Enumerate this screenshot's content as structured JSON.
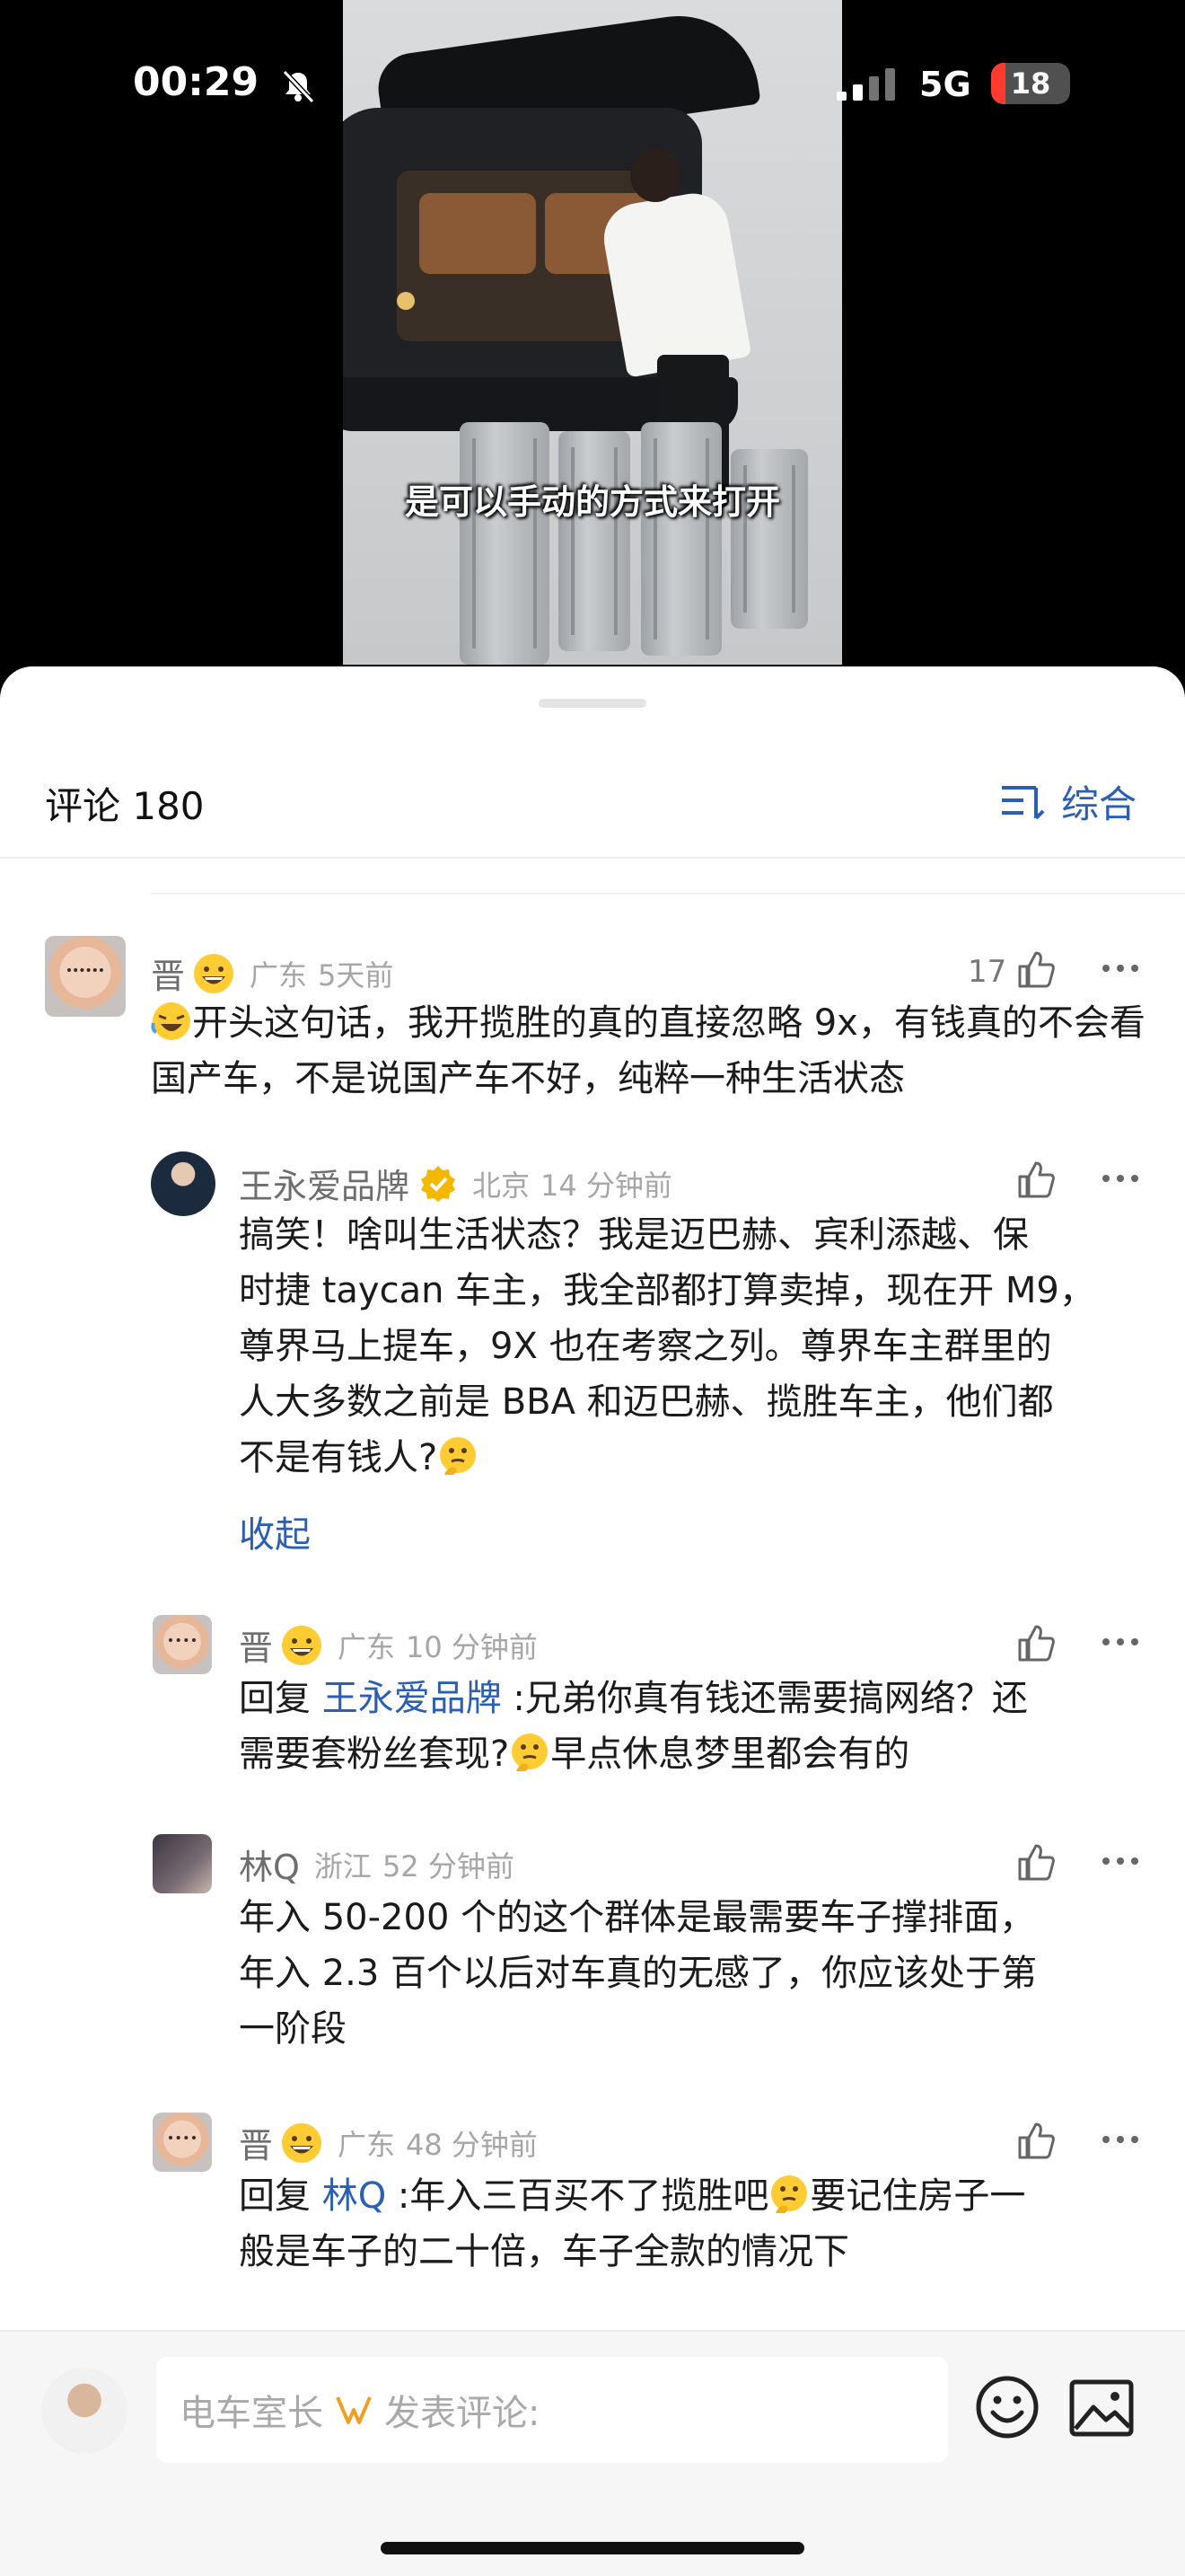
{
  "status_bar": {
    "time": "00:29",
    "network": "5G",
    "battery": "18",
    "battery_fraction": 0.18
  },
  "video": {
    "subtitle": "是可以手动的方式来打开"
  },
  "comments_header": {
    "title": "评论 180",
    "sort_label": "综合"
  },
  "comments": [
    {
      "name": "晋",
      "location": "广东",
      "time": "5天前",
      "likes": "17",
      "text": "开头这句话，我开揽胜的真的直接忽略 9x，有钱真的不会看国产车，不是说国产车不好，纯粹一种生活状态"
    },
    {
      "name": "王永爱品牌",
      "location": "北京",
      "time": "14 分钟前",
      "lines": [
        "搞笑！啥叫生活状态？我是迈巴赫、宾利添越、保",
        "时捷 taycan 车主，我全部都打算卖掉，现在开 M9，",
        "尊界马上提车，9X 也在考察之列。尊界车主群里的",
        "人大多数之前是 BBA 和迈巴赫、揽胜车主，他们都",
        "不是有钱人?"
      ],
      "collapse": "收起"
    },
    {
      "name": "晋",
      "location": "广东",
      "time": "10 分钟前",
      "reply_prefix": "回复",
      "reply_to": "王永爱品牌",
      "lines": [
        " :兄弟你真有钱还需要搞网络？还",
        "需要套粉丝套现?",
        "早点休息梦里都会有的"
      ]
    },
    {
      "name": "林Q",
      "location": "浙江",
      "time": "52 分钟前",
      "lines": [
        "年入 50-200 个的这个群体是最需要车子撑排面，",
        "年入 2.3 百个以后对车真的无感了，你应该处于第",
        "一阶段"
      ]
    },
    {
      "name": "晋",
      "location": "广东",
      "time": "48 分钟前",
      "reply_prefix": "回复",
      "reply_to": "林Q",
      "lines": [
        " :年入三百买不了揽胜吧",
        "要记住房子一",
        "般是车子的二十倍，车子全款的情况下"
      ]
    }
  ],
  "input_bar": {
    "prefix": "电车室长",
    "placeholder": "发表评论:"
  },
  "icons": {
    "like": "thumbs-up-icon",
    "more": "more-icon",
    "sort": "sort-icon",
    "emoji": "emoji-icon",
    "image": "image-icon",
    "verified": "verified-badge-icon",
    "muted": "bell-slash-icon",
    "signal": "signal-icon"
  },
  "colors": {
    "accent": "#2b5fb3",
    "battery_low": "#ff3b30",
    "verified": "#f5b800"
  }
}
